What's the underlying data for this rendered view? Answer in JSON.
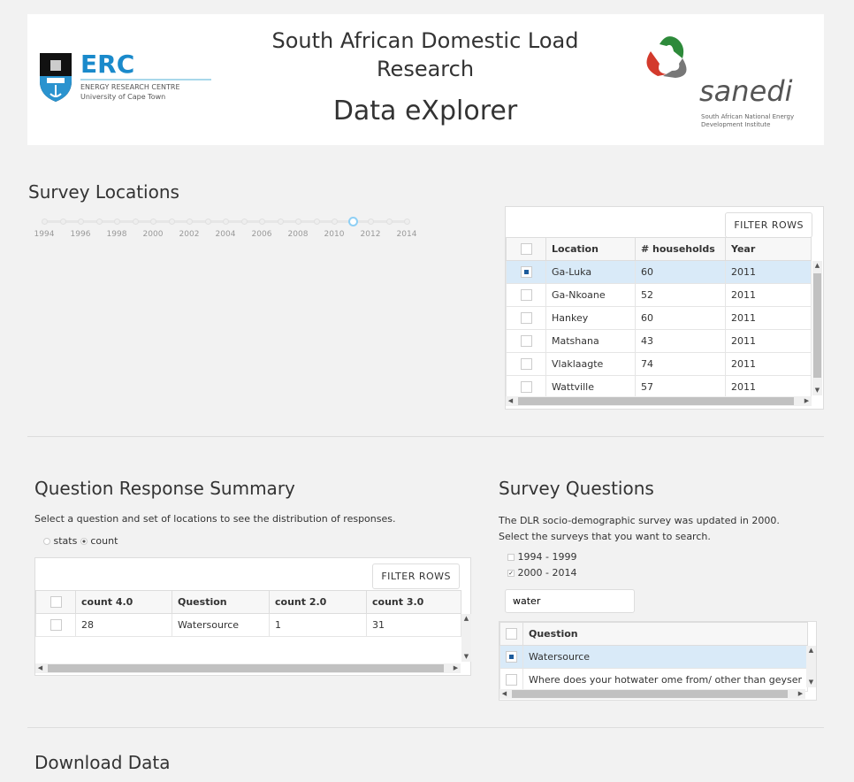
{
  "header": {
    "title_line1": "South African Domestic Load",
    "title_line2": "Research",
    "subtitle": "Data eXplorer",
    "erc_logo": {
      "big": "ERC",
      "line1": "ENERGY RESEARCH CENTRE",
      "line2": "University of Cape Town"
    },
    "sanedi_logo": {
      "big": "sanedi",
      "line1": "South African National Energy",
      "line2": "Development Institute"
    }
  },
  "survey_locations": {
    "title": "Survey Locations",
    "slider": {
      "min": 1994,
      "max": 2014,
      "value": 2011,
      "labels": [
        "1994",
        "1996",
        "1998",
        "2000",
        "2002",
        "2004",
        "2006",
        "2008",
        "2010",
        "2012",
        "2014"
      ]
    },
    "filter_label": "FILTER ROWS",
    "columns": [
      "Location",
      "# households",
      "Year"
    ],
    "rows": [
      {
        "location": "Ga-Luka",
        "households": "60",
        "year": "2011",
        "selected": true
      },
      {
        "location": "Ga-Nkoane",
        "households": "52",
        "year": "2011",
        "selected": false
      },
      {
        "location": "Hankey",
        "households": "60",
        "year": "2011",
        "selected": false
      },
      {
        "location": "Matshana",
        "households": "43",
        "year": "2011",
        "selected": false
      },
      {
        "location": "Vlaklaagte",
        "households": "74",
        "year": "2011",
        "selected": false
      },
      {
        "location": "Wattville",
        "households": "57",
        "year": "2011",
        "selected": false
      }
    ]
  },
  "response_summary": {
    "title": "Question Response Summary",
    "description": "Select a question and set of locations to see the distribution of responses.",
    "radio": [
      {
        "label": "stats",
        "checked": false
      },
      {
        "label": "count",
        "checked": true
      }
    ],
    "filter_label": "FILTER ROWS",
    "columns": [
      "count 4.0",
      "Question",
      "count 2.0",
      "count 3.0"
    ],
    "rows": [
      [
        "28",
        "Watersource",
        "1",
        "31"
      ]
    ]
  },
  "survey_questions": {
    "title": "Survey Questions",
    "description": "The DLR socio-demographic survey was updated in 2000. Select the surveys that you want to search.",
    "checkboxes": [
      {
        "label": "1994 - 1999",
        "checked": false
      },
      {
        "label": "2000 - 2014",
        "checked": true
      }
    ],
    "search_value": "water",
    "column": "Question",
    "rows": [
      {
        "question": "Watersource",
        "selected": true
      },
      {
        "question": "Where does your hotwater ome from/ other than geyser",
        "selected": false
      }
    ]
  },
  "download": {
    "title": "Download Data"
  },
  "colors": {
    "accent": "#1d5c9c",
    "selected_row": "#d9eaf8",
    "slider_handle": "#8fd0f5"
  }
}
